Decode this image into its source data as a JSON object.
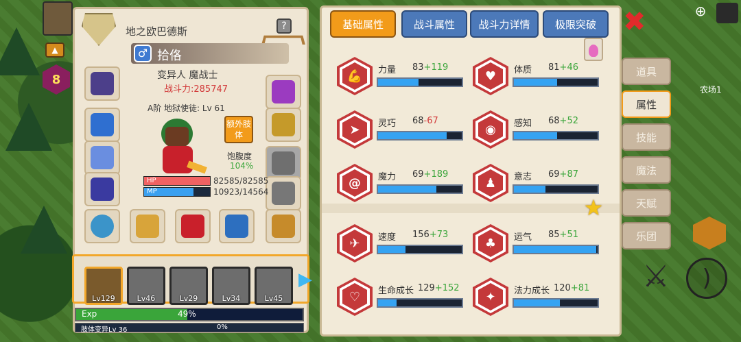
{
  "character": {
    "title": "地之欧巴德斯",
    "name": "拾佫",
    "class": "变异人 魔战士",
    "power": "战斗力:285747",
    "rank": "A阶 地狱使徒: Lv 61",
    "extra_limb": "额外肢体",
    "satiety_label": "饱腹度",
    "satiety_value": "104%",
    "hp_label": "HP",
    "hp_text": "82585/82585",
    "hp_ratio": 1.0,
    "mp_label": "MP",
    "mp_text": "10923/14564",
    "mp_ratio": 0.75
  },
  "party": [
    {
      "label": "Lv129"
    },
    {
      "label": "Lv46"
    },
    {
      "label": "Lv29"
    },
    {
      "label": "Lv34"
    },
    {
      "label": "Lv45"
    }
  ],
  "exp": {
    "label": "Exp",
    "percent": "49%",
    "ratio": 0.49,
    "sub_label": "肢体变异Lv 36",
    "sub_percent": "0%"
  },
  "tabs": [
    "基础属性",
    "战斗属性",
    "战斗力详情",
    "极限突破"
  ],
  "stats": [
    {
      "label": "力量",
      "base": "83",
      "bonus": "+119",
      "bonus_type": "plus",
      "ratio": 0.48,
      "icon": "arm"
    },
    {
      "label": "体质",
      "base": "81",
      "bonus": "+46",
      "bonus_type": "plus",
      "ratio": 0.52,
      "icon": "body"
    },
    {
      "label": "灵巧",
      "base": "68",
      "bonus": "-67",
      "bonus_type": "minus",
      "ratio": 0.82,
      "icon": "run"
    },
    {
      "label": "感知",
      "base": "68",
      "bonus": "+52",
      "bonus_type": "plus",
      "ratio": 0.52,
      "icon": "eye"
    },
    {
      "label": "魔力",
      "base": "69",
      "bonus": "+189",
      "bonus_type": "plus",
      "ratio": 0.7,
      "icon": "spiral"
    },
    {
      "label": "意志",
      "base": "69",
      "bonus": "+87",
      "bonus_type": "plus",
      "ratio": 0.38,
      "icon": "head"
    },
    {
      "label": "速度",
      "base": "156",
      "bonus": "+73",
      "bonus_type": "plus",
      "ratio": 0.33,
      "icon": "wing"
    },
    {
      "label": "运气",
      "base": "85",
      "bonus": "+51",
      "bonus_type": "plus",
      "ratio": 0.98,
      "icon": "clover"
    },
    {
      "label": "生命成长",
      "base": "129",
      "bonus": "+152",
      "bonus_type": "plus",
      "ratio": 0.22,
      "icon": "heart"
    },
    {
      "label": "法力成长",
      "base": "120",
      "bonus": "+81",
      "bonus_type": "plus",
      "ratio": 0.55,
      "icon": "star"
    }
  ],
  "side_tabs": [
    "道具",
    "属性",
    "技能",
    "魔法",
    "天赋",
    "乐团"
  ],
  "hud": {
    "level_badge": "8",
    "farm_label": "农场1"
  },
  "colors": {
    "accent": "#f29b1a",
    "stat_red": "#c4393a",
    "bar_blue": "#35a3f2"
  }
}
